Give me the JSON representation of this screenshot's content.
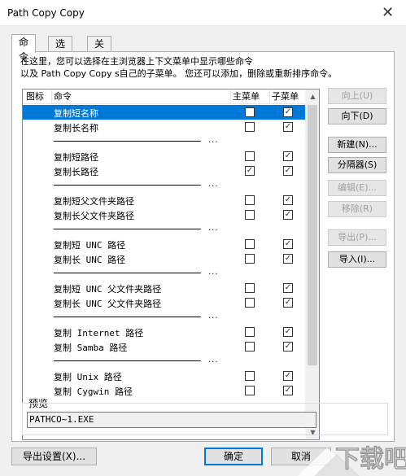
{
  "window": {
    "title": "Path Copy Copy",
    "close_glyph": "✕"
  },
  "tabs": [
    {
      "label": "命令",
      "active": true
    },
    {
      "label": "选项",
      "active": false
    },
    {
      "label": "关于",
      "active": false
    }
  ],
  "description": {
    "line1": "在这里，您可以选择在主浏览器上下文菜单中显示哪些命令",
    "line2": "以及 Path Copy Copy s自己的子菜单。 您还可以添加，删除或重新排序命令。"
  },
  "list": {
    "headers": {
      "icon": "图标",
      "command": "命令",
      "main_menu": "主菜单",
      "sub_menu": "子菜单"
    },
    "separator_text": "...",
    "rows": [
      {
        "type": "cmd",
        "name": "复制短名称",
        "main": false,
        "sub": true,
        "selected": true
      },
      {
        "type": "cmd",
        "name": "复制长名称",
        "main": false,
        "sub": true
      },
      {
        "type": "sep"
      },
      {
        "type": "cmd",
        "name": "复制短路径",
        "main": false,
        "sub": true
      },
      {
        "type": "cmd",
        "name": "复制长路径",
        "main": true,
        "sub": true
      },
      {
        "type": "sep"
      },
      {
        "type": "cmd",
        "name": "复制短父文件夹路径",
        "main": false,
        "sub": true
      },
      {
        "type": "cmd",
        "name": "复制长父文件夹路径",
        "main": false,
        "sub": true
      },
      {
        "type": "sep"
      },
      {
        "type": "cmd",
        "name": "复制短 UNC 路径",
        "main": false,
        "sub": true
      },
      {
        "type": "cmd",
        "name": "复制长 UNC 路径",
        "main": false,
        "sub": true
      },
      {
        "type": "sep"
      },
      {
        "type": "cmd",
        "name": "复制短 UNC 父文件夹路径",
        "main": false,
        "sub": true
      },
      {
        "type": "cmd",
        "name": "复制长 UNC 父文件夹路径",
        "main": false,
        "sub": true
      },
      {
        "type": "sep"
      },
      {
        "type": "cmd",
        "name": "复制 Internet 路径",
        "main": false,
        "sub": true
      },
      {
        "type": "cmd",
        "name": "复制 Samba 路径",
        "main": false,
        "sub": true
      },
      {
        "type": "sep"
      },
      {
        "type": "cmd",
        "name": "复制 Unix 路径",
        "main": false,
        "sub": true
      },
      {
        "type": "cmd",
        "name": "复制 Cygwin 路径",
        "main": false,
        "sub": true
      }
    ]
  },
  "side_buttons": [
    {
      "label": "向上(U)",
      "enabled": false
    },
    {
      "label": "向下(D)",
      "enabled": true
    },
    {
      "label": "新建(N)...",
      "enabled": true
    },
    {
      "label": "分隔器(S)",
      "enabled": true
    },
    {
      "label": "编辑(E)...",
      "enabled": false
    },
    {
      "label": "移除(R)",
      "enabled": false
    },
    {
      "label": "导出(P)...",
      "enabled": false
    },
    {
      "label": "导入(I)...",
      "enabled": true
    }
  ],
  "preview": {
    "label": "预览",
    "value": "PATHCO~1.EXE"
  },
  "footer": {
    "export_settings": "导出设置(X)...",
    "ok": "确定",
    "cancel": "取消"
  },
  "watermark": {
    "text": "下载吧"
  },
  "colors": {
    "selection": "#0078d7",
    "window_bg": "#f0f0f0",
    "watermark": "#ffffff"
  }
}
